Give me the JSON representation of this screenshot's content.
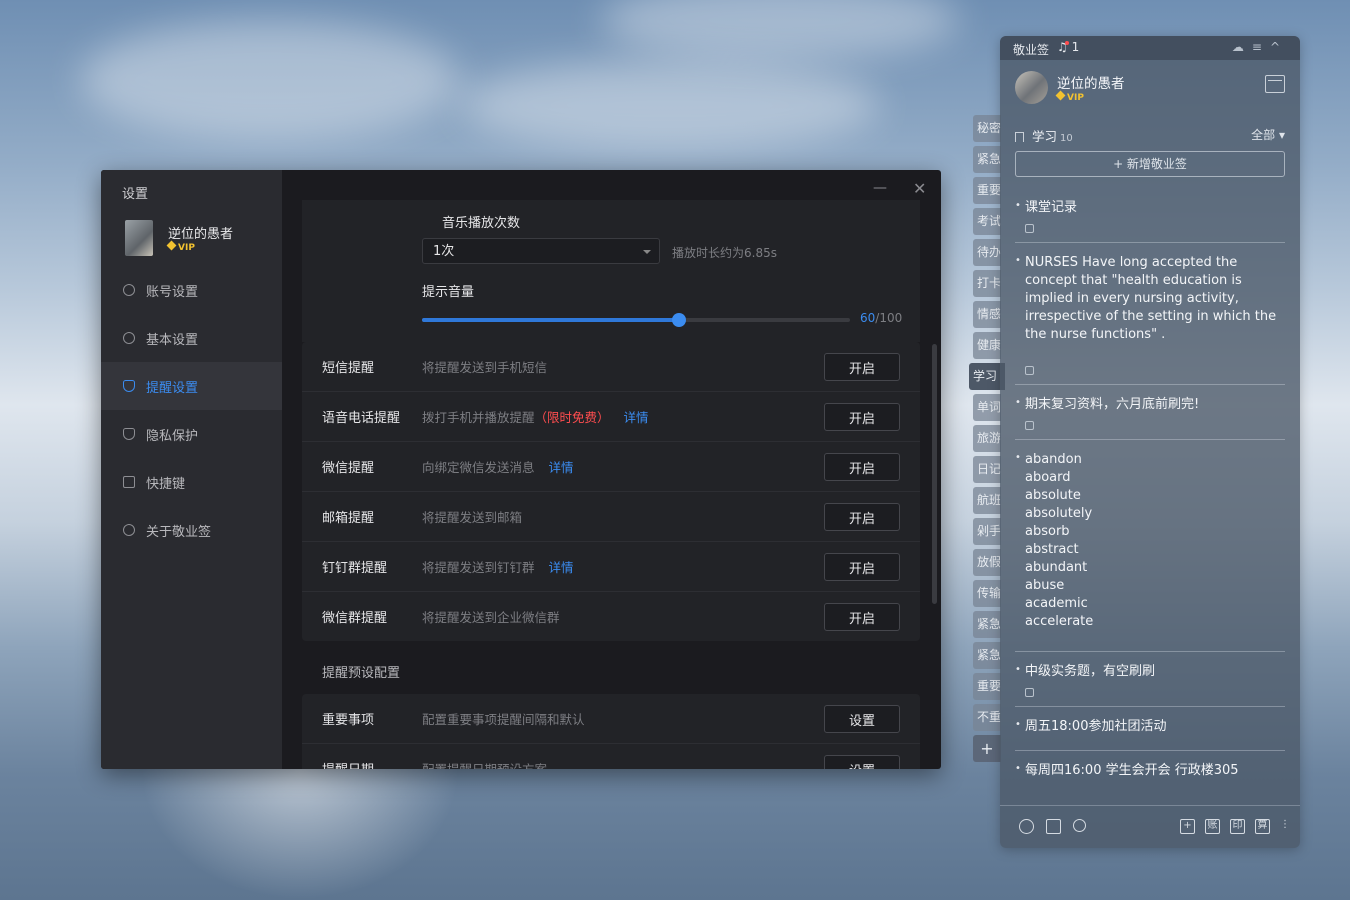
{
  "settings": {
    "title": "设置",
    "user": {
      "name": "逆位的愚者",
      "badge": "VIP"
    },
    "nav": [
      {
        "label": "账号设置",
        "icon": "user-icon",
        "active": false
      },
      {
        "label": "基本设置",
        "icon": "settings-icon",
        "active": false
      },
      {
        "label": "提醒设置",
        "icon": "bell-icon",
        "active": true
      },
      {
        "label": "隐私保护",
        "icon": "shield-icon",
        "active": false
      },
      {
        "label": "快捷键",
        "icon": "keyboard-icon",
        "active": false
      },
      {
        "label": "关于敬业签",
        "icon": "info-icon",
        "active": false
      }
    ],
    "music": {
      "label": "音乐播放次数",
      "value": "1次",
      "duration_hint": "播放时长约为6.85s"
    },
    "volume": {
      "label": "提示音量",
      "value": 60,
      "max": 100,
      "readout_value": "60",
      "readout_max": "/100"
    },
    "reminders": [
      {
        "label": "短信提醒",
        "desc": "将提醒发送到手机短信",
        "extra": "",
        "link": "",
        "button": "开启"
      },
      {
        "label": "语音电话提醒",
        "desc": "拨打手机并播放提醒",
        "extra": "（限时免费）",
        "link": "详情",
        "button": "开启"
      },
      {
        "label": "微信提醒",
        "desc": "向绑定微信发送消息",
        "extra": "",
        "link": "详情",
        "button": "开启"
      },
      {
        "label": "邮箱提醒",
        "desc": "将提醒发送到邮箱",
        "extra": "",
        "link": "",
        "button": "开启"
      },
      {
        "label": "钉钉群提醒",
        "desc": "将提醒发送到钉钉群",
        "extra": "",
        "link": "详情",
        "button": "开启"
      },
      {
        "label": "微信群提醒",
        "desc": "将提醒发送到企业微信群",
        "extra": "",
        "link": "",
        "button": "开启"
      }
    ],
    "preset_section": "提醒预设配置",
    "presets": [
      {
        "label": "重要事项",
        "desc": "配置重要事项提醒间隔和默认",
        "button": "设置"
      },
      {
        "label": "提醒日期",
        "desc": "配置提醒日期预设方案",
        "button": "设置"
      }
    ]
  },
  "notes": {
    "app_name": "敬业签",
    "bell_count": "1",
    "user": {
      "name": "逆位的愚者",
      "badge": "VIP"
    },
    "category": {
      "name": "学习",
      "count": "10",
      "filter": "全部"
    },
    "add_label": "+ 新增敬业签",
    "items": [
      {
        "text": "课堂记录",
        "lock": true
      },
      {
        "text": "NURSES Have long accepted the concept that \"health education is implied in every nursing activity, irrespective of the setting in which the the nurse functions\" .",
        "lock": true
      },
      {
        "text": "期末复习资料，六月底前刷完!",
        "lock": true
      },
      {
        "text": "abandon\naboard\nabsolute\nabsolutely\nabsorb\nabstract\nabundant\nabuse\nacademic\naccelerate",
        "lock": false
      },
      {
        "text": "中级实务题，有空刷刷",
        "lock": true
      },
      {
        "text": "周五18:00参加社团活动",
        "lock": false
      },
      {
        "text": "每周四16:00 学生会开会 行政楼305",
        "lock": false
      }
    ],
    "bottom_icons": [
      "clock-icon",
      "calendar-check-icon",
      "search-icon",
      "plus-icon",
      "账",
      "印",
      "算",
      "more-icon"
    ]
  },
  "tabs": [
    "秘密",
    "紧急",
    "重要",
    "考试",
    "待办",
    "打卡",
    "情感",
    "健康",
    "学习",
    "单词",
    "旅游",
    "日记",
    "航班",
    "剁手",
    "放假",
    "传输",
    "紧急",
    "紧急",
    "重要",
    "不重",
    "+"
  ]
}
